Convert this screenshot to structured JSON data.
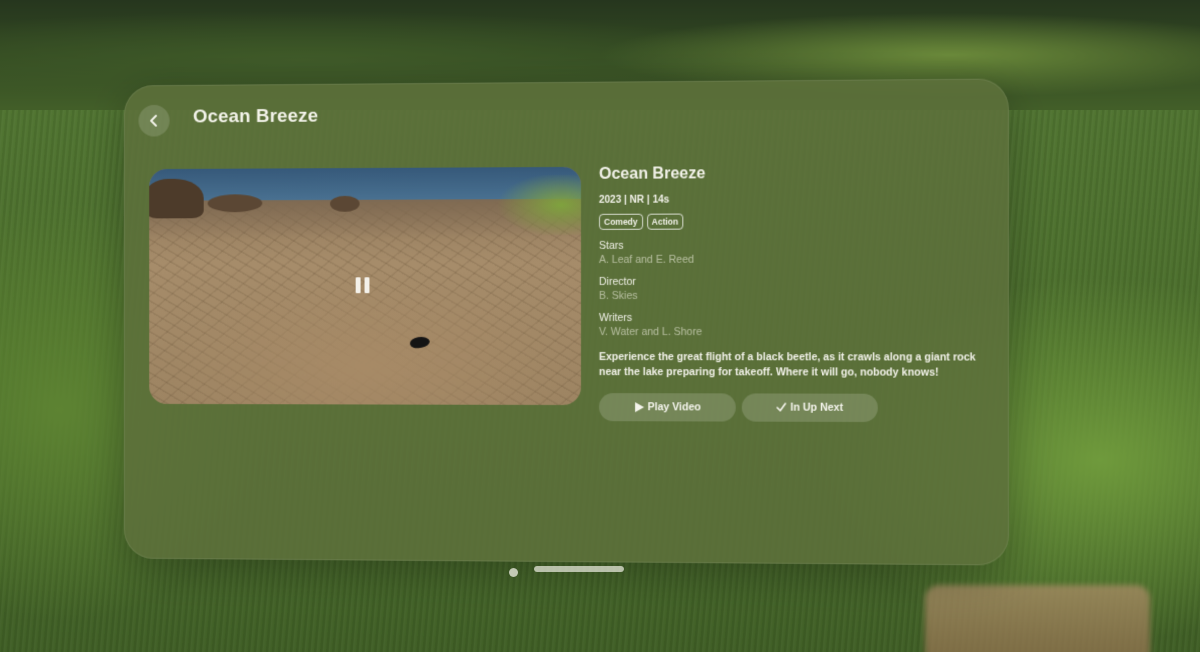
{
  "window": {
    "title": "Ocean Breeze"
  },
  "video": {
    "state": "paused",
    "pause_icon": "pause-icon"
  },
  "details": {
    "title": "Ocean Breeze",
    "meta": "2023 | NR | 14s",
    "genres": [
      "Comedy",
      "Action"
    ],
    "stars_label": "Stars",
    "stars_value": "A. Leaf and E. Reed",
    "director_label": "Director",
    "director_value": "B. Skies",
    "writers_label": "Writers",
    "writers_value": "V. Water and L. Shore",
    "description": "Experience the great flight of a black beetle, as it crawls along a giant rock near the lake preparing for takeoff. Where it will go, nobody knows!"
  },
  "actions": {
    "play_label": "Play Video",
    "up_next_label": "In Up Next"
  },
  "colors": {
    "glass": "#5c703a",
    "text": "#f1f1e8"
  }
}
